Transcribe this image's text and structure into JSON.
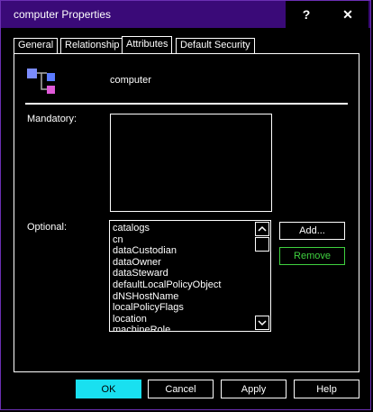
{
  "window": {
    "title": "computer Properties",
    "help_glyph": "?",
    "close_glyph": "✕"
  },
  "tabs": [
    {
      "label": "General",
      "active": false
    },
    {
      "label": "Relationship",
      "active": false
    },
    {
      "label": "Attributes",
      "active": true
    },
    {
      "label": "Default Security",
      "active": false
    }
  ],
  "object": {
    "class_name": "computer",
    "icon": "class-hierarchy-icon"
  },
  "mandatory": {
    "label": "Mandatory:",
    "items": []
  },
  "optional": {
    "label": "Optional:",
    "items": [
      "catalogs",
      "cn",
      "dataCustodian",
      "dataOwner",
      "dataSteward",
      "defaultLocalPolicyObject",
      "dNSHostName",
      "localPolicyFlags",
      "location",
      "machineRole"
    ],
    "add_label": "Add...",
    "remove_label": "Remove"
  },
  "footer": {
    "ok_label": "OK",
    "cancel_label": "Cancel",
    "apply_label": "Apply",
    "help_label": "Help"
  },
  "colors": {
    "titlebar": "#3a0a78",
    "border": "#6b2fb3",
    "ok_button": "#19e0f0",
    "remove_text": "#3fd13f"
  }
}
